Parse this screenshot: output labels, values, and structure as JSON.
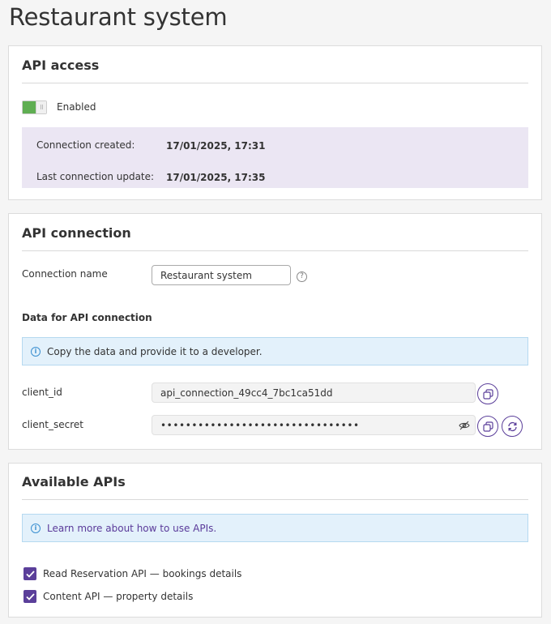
{
  "page": {
    "title": "Restaurant system"
  },
  "api_access": {
    "title": "API access",
    "toggle": {
      "enabled": true,
      "label": "Enabled"
    },
    "info": [
      {
        "label": "Connection created:",
        "value": "17/01/2025, 17:31"
      },
      {
        "label": "Last connection update:",
        "value": "17/01/2025, 17:35"
      }
    ]
  },
  "api_connection": {
    "title": "API connection",
    "name_label": "Connection name",
    "name_value": "Restaurant system",
    "data_heading": "Data for API connection",
    "note": "Copy the data and provide it to a developer.",
    "client_id_label": "client_id",
    "client_id_value": "api_connection_49cc4_7bc1ca51dd",
    "client_secret_label": "client_secret",
    "client_secret_value": "••••••••••••••••••••••••••••••••"
  },
  "available_apis": {
    "title": "Available APIs",
    "note_link": "Learn more about how to use APIs.",
    "items": [
      {
        "label": "Read Reservation API — bookings details",
        "checked": true
      },
      {
        "label": "Content API — property details",
        "checked": true
      }
    ]
  },
  "colors": {
    "accent": "#5b3f9a",
    "toggle_on": "#5fae52",
    "info_band": "#ebe6f3",
    "note_bg": "#e3f1fb"
  },
  "icons": [
    "help-icon",
    "info-icon",
    "copy-icon",
    "eye-off-icon",
    "refresh-icon",
    "check-icon"
  ]
}
